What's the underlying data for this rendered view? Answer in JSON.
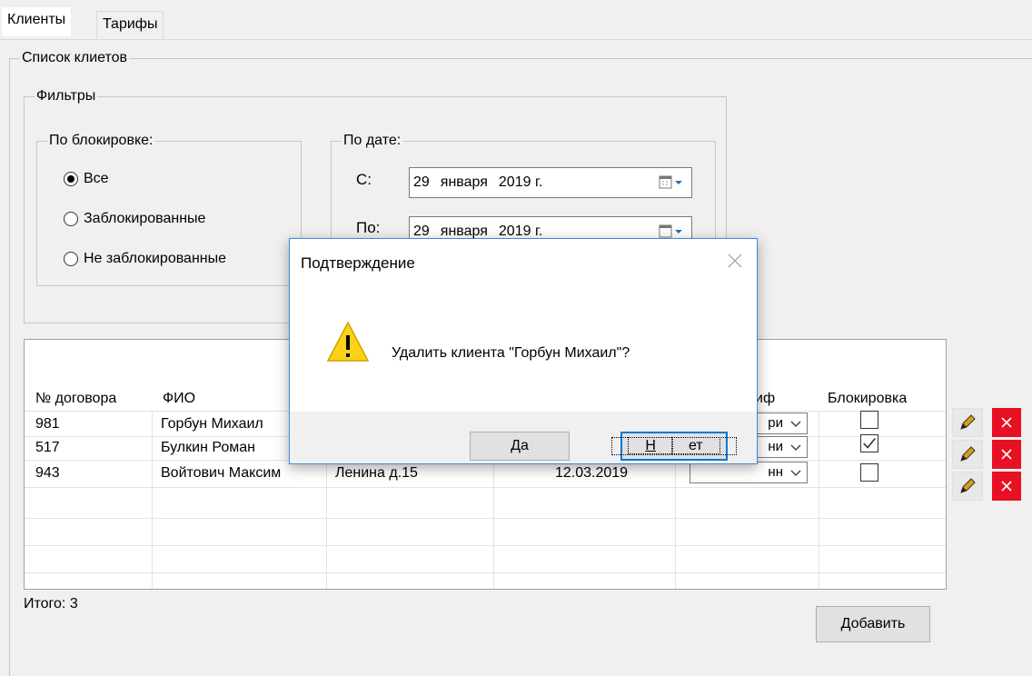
{
  "tabs": [
    "Клиенты",
    "Тарифы"
  ],
  "client_list": {
    "legend": "Список клиетов"
  },
  "filters": {
    "legend": "Фильтры",
    "by_block": {
      "legend": "По блокировке:",
      "options": [
        "Все",
        "Заблокированные",
        "Не заблокированные"
      ],
      "selected": "Все"
    },
    "by_date": {
      "legend": "По дате:",
      "from_label": "С:",
      "to_label": "По:",
      "from": {
        "day": "29",
        "month": "января",
        "year": "2019 г."
      },
      "to": {
        "day": "29",
        "month": "января",
        "year": "2019 г."
      }
    }
  },
  "table": {
    "headers": {
      "contract": "№ договора",
      "name": "ФИО",
      "tariff": "иф",
      "block": "Блокировка"
    },
    "rows": [
      {
        "contract": "981",
        "name": "Горбун Михаил",
        "address": "",
        "date": "",
        "tariff": "ри",
        "blocked": false
      },
      {
        "contract": "517",
        "name": "Булкин Роман",
        "address": "",
        "date": "",
        "tariff": "ни",
        "blocked": true
      },
      {
        "contract": "943",
        "name": "Войтович Максим",
        "address": "Ленина д.15",
        "date": "12.03.2019",
        "tariff": "нн",
        "blocked": false
      }
    ]
  },
  "total_label": "Итого: 3",
  "add_button": "Добавить",
  "dialog": {
    "title": "Подтверждение",
    "message": "Удалить клиента \"Горбун Михаил\"?",
    "yes_prefix": "",
    "yes_underlined": "Д",
    "yes_rest": "а",
    "no_underlined": "Н",
    "no_rest": "ет"
  },
  "icons": {
    "warning": "warning-icon",
    "edit": "pencil-icon",
    "delete": "delete-x-icon",
    "close": "close-icon",
    "calendar": "calendar-icon"
  },
  "colors": {
    "delete_button": "#e81123",
    "dialog_border": "#3c8cdc",
    "default_button_border": "#0078d7"
  }
}
